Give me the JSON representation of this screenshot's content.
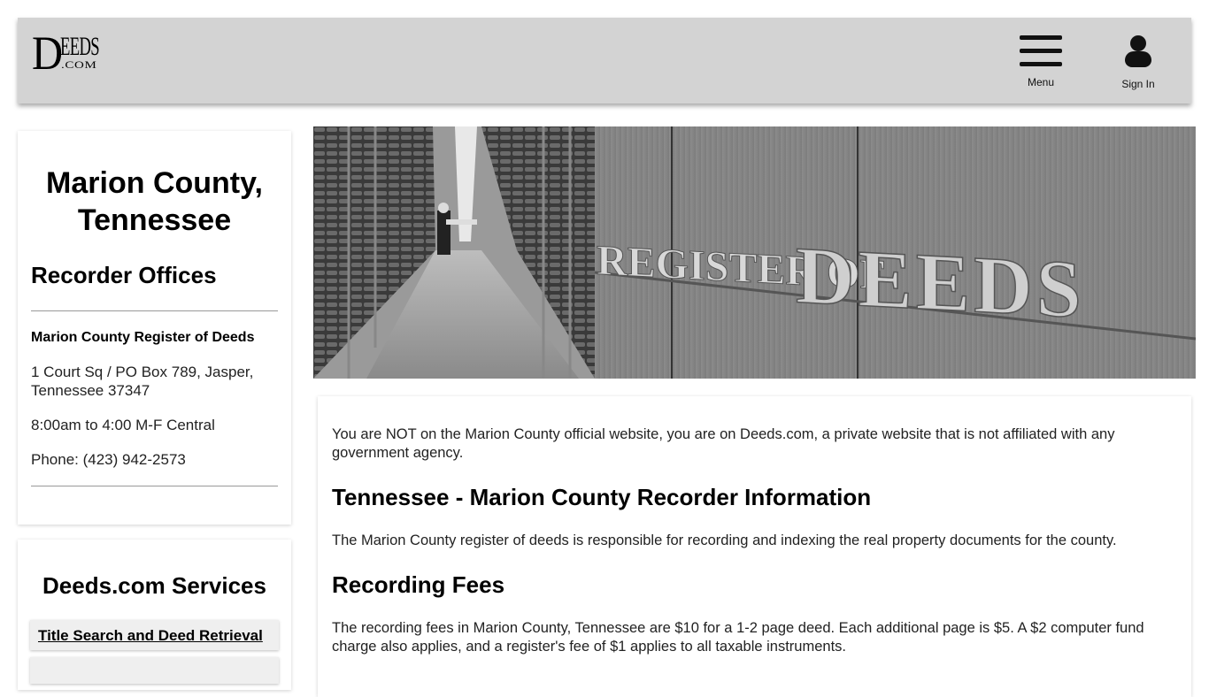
{
  "header": {
    "logo": {
      "big_letter": "D",
      "rest": "EEDS",
      "suffix": ".COM"
    },
    "menu_label": "Menu",
    "signin_label": "Sign In",
    "menu_icon": "hamburger-icon",
    "signin_icon": "user-icon"
  },
  "sidebar": {
    "county_title": "Marion County, Tennessee",
    "offices_heading": "Recorder Offices",
    "office": {
      "name": "Marion County Register of Deeds",
      "address": "1 Court Sq / PO Box 789, Jasper, Tennessee 37347",
      "hours": "8:00am to 4:00 M-F Central",
      "phone": "Phone: (423) 942-2573"
    },
    "services_heading": "Deeds.com Services",
    "services": [
      {
        "label": "Title Search and Deed Retrieval"
      }
    ]
  },
  "hero": {
    "sign_text_left": "REGISTER OF",
    "sign_text_right": "DEEDS"
  },
  "main": {
    "disclaimer": "You are NOT on the Marion County official website, you are on Deeds.com, a private website that is not affiliated with any government agency.",
    "sections": [
      {
        "heading": "Tennessee - Marion County Recorder Information",
        "text": "The Marion County register of deeds is responsible for recording and indexing the real property documents for the county."
      },
      {
        "heading": "Recording Fees",
        "text": "The recording fees in Marion County, Tennessee are $10 for a 1-2 page deed. Each additional page is $5. A $2 computer fund charge also applies, and a register's fee of $1 applies to all taxable instruments."
      }
    ]
  }
}
